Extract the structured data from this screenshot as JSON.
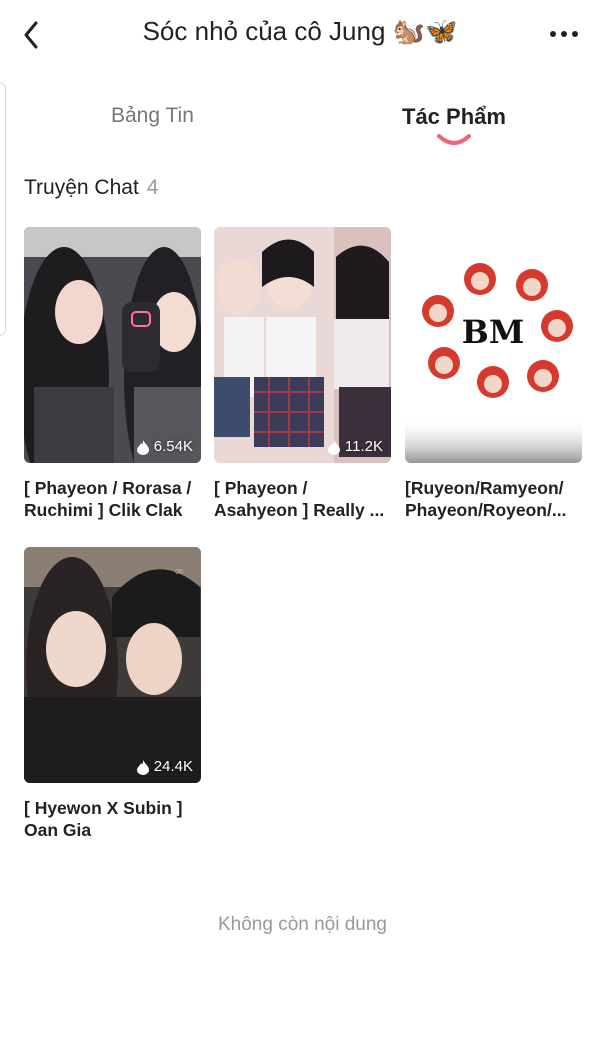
{
  "header": {
    "title": "Sóc nhỏ của cô Jung 🐿️🦋",
    "back_icon": "chevron-left-icon",
    "more_icon": "more-horizontal-icon"
  },
  "tabs": [
    {
      "label": "Bảng Tin",
      "active": false
    },
    {
      "label": "Tác Phẩm",
      "active": true
    }
  ],
  "accent_color": "#f0637a",
  "section": {
    "title": "Truyện Chat",
    "count": "4"
  },
  "stories": [
    {
      "title": "[ Phayeon / Rorasa / Ruchimi ] Clik Clak",
      "views": "6.54K",
      "thumb": "two-person-selfie"
    },
    {
      "title": "[ Phayeon / Asahyeon ] Really ...",
      "views": "11.2K",
      "thumb": "school-uniform-group"
    },
    {
      "title": "[Ruyeon/Ramyeon/ Phayeon/Royeon/...",
      "views": "",
      "thumb": "tomato-faces-logo",
      "logo_text": "BM"
    },
    {
      "title": "[ Hyewon X Subin ] Oan Gia",
      "views": "24.4K",
      "thumb": "two-person-selfie-beanie"
    }
  ],
  "footer": {
    "text": "Không còn nội dung"
  }
}
